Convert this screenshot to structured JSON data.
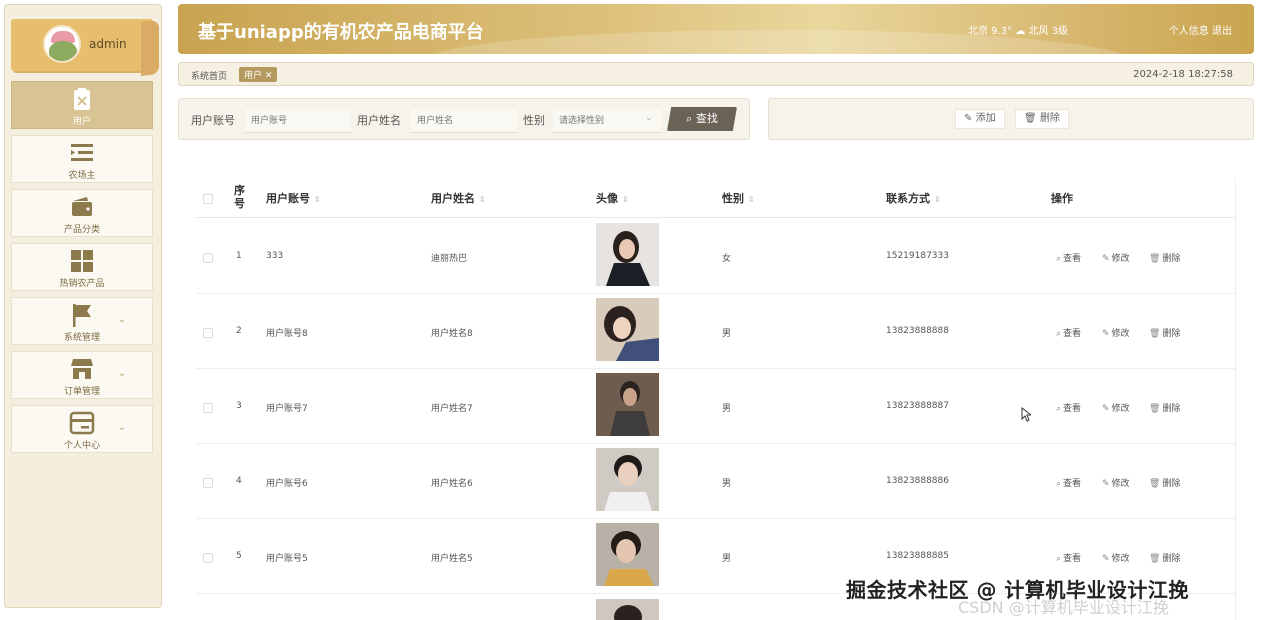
{
  "user": {
    "name": "admin"
  },
  "sidebar": {
    "items": [
      {
        "label": "用户",
        "icon": "clipboard-x-icon",
        "active": true
      },
      {
        "label": "农场主",
        "icon": "list-indent-icon"
      },
      {
        "label": "产品分类",
        "icon": "wallet-icon"
      },
      {
        "label": "热销农产品",
        "icon": "grid-icon"
      },
      {
        "label": "系统管理",
        "icon": "flag-icon",
        "expandable": true
      },
      {
        "label": "订单管理",
        "icon": "shop-icon",
        "expandable": true
      },
      {
        "label": "个人中心",
        "icon": "card-icon",
        "expandable": true
      }
    ]
  },
  "header": {
    "title": "基于uniapp的有机农产品电商平台",
    "weather": "北京  9.3°  ☁ 北风  3级",
    "profile": "个人信息",
    "logout": "退出"
  },
  "breadcrumb": {
    "home": "系统首页",
    "tag": "用户 ✕",
    "time": "2024-2-18 18:27:58"
  },
  "search": {
    "account_label": "用户账号",
    "account_placeholder": "用户账号",
    "name_label": "用户姓名",
    "name_placeholder": "用户姓名",
    "gender_label": "性别",
    "gender_placeholder": "请选择性别",
    "button": "查找"
  },
  "actions": {
    "add": "添加",
    "delete": "删除"
  },
  "table": {
    "headers": {
      "seq": "序号",
      "account": "用户账号",
      "name": "用户姓名",
      "avatar": "头像",
      "gender": "性别",
      "phone": "联系方式",
      "ops": "操作"
    },
    "ops": {
      "view": "查看",
      "edit": "修改",
      "delete": "删除"
    },
    "rows": [
      {
        "seq": "1",
        "account": "333",
        "name": "迪丽热巴",
        "gender": "女",
        "phone": "15219187333"
      },
      {
        "seq": "2",
        "account": "用户账号8",
        "name": "用户姓名8",
        "gender": "男",
        "phone": "13823888888"
      },
      {
        "seq": "3",
        "account": "用户账号7",
        "name": "用户姓名7",
        "gender": "男",
        "phone": "13823888887"
      },
      {
        "seq": "4",
        "account": "用户账号6",
        "name": "用户姓名6",
        "gender": "男",
        "phone": "13823888886"
      },
      {
        "seq": "5",
        "account": "用户账号5",
        "name": "用户姓名5",
        "gender": "男",
        "phone": "13823888885"
      }
    ]
  },
  "watermark": "掘金技术社区 @ 计算机毕业设计江挽",
  "watermark_faint": "CSDN @计算机毕业设计江挽"
}
